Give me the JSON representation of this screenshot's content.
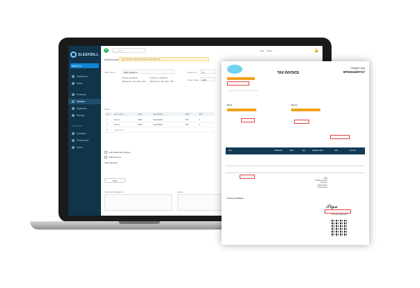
{
  "app": {
    "brand": "SLEEKBILL",
    "company_selector": "Demo Co",
    "search_placeholder": "Search",
    "topbar_links": [
      "Help",
      "Share"
    ],
    "form_title": "Edit Invoice",
    "warning": "Your GSTR-1 for this period is not filed yet"
  },
  "sidebar": {
    "items": [
      {
        "label": "Dashboard"
      },
      {
        "label": "Sales"
      },
      {
        "label": "Purchase"
      },
      {
        "label": "Invoices"
      },
      {
        "label": "Expenses"
      },
      {
        "label": "Reports"
      }
    ],
    "section": "SETTINGS",
    "settings_items": [
      {
        "label": "Company"
      },
      {
        "label": "Preferences"
      },
      {
        "label": "Users"
      }
    ]
  },
  "invoice_form": {
    "party_label": "Party name",
    "party_value": "ABC Solutions",
    "billing_label": "BILLING ADDRESS",
    "shipping_label": "SHIPPING ADDRESS",
    "billing_address": "Address line, City, State - PIN",
    "shipping_address": "Address line, City, State - PIN",
    "invoice_no_label": "Invoice no",
    "invoice_no_value": "12",
    "date_label": "Invoice date",
    "date_value": "2021",
    "items_label": "Items",
    "columns": [
      "No",
      "Item name",
      "HSN",
      "Description",
      "Rate",
      "QTY"
    ],
    "rows": [
      {
        "no": "1",
        "name": "Item 1",
        "hsn": "1001",
        "desc": "Description",
        "rate": "100",
        "qty": "1"
      },
      {
        "no": "2",
        "name": "Item 2",
        "hsn": "1002",
        "desc": "Description",
        "rate": "100",
        "qty": "1"
      },
      {
        "no": "3",
        "name": "Select item",
        "hsn": "",
        "desc": "",
        "rate": "",
        "qty": ""
      }
    ],
    "checkboxes": [
      "Add Additional Charges",
      "Add Discount"
    ],
    "add_signature": "Add Signature",
    "save_button": "Save",
    "terms_label": "Terms & Conditions",
    "notes_label": "Notes"
  },
  "invoice_doc": {
    "title": "TAX INVOICE",
    "copy_label": "Original Copy",
    "invoice_number": "SPI/2024/07/17",
    "bill_to": "Bill To",
    "ship_to": "Ship To",
    "table_headers": [
      "Item",
      "HSN/SAC",
      "Rate",
      "Qty",
      "Taxable Value",
      "GST",
      "Amount"
    ],
    "totals": [
      "Total",
      "Taxable Amount",
      "Total Tax",
      "Total Amount",
      "Amount Due"
    ],
    "terms_label": "Terms & Conditions",
    "signature": "Authorised Signatory"
  },
  "colors": {
    "sidebar": "#12344a",
    "accent": "#0e86d4",
    "highlight": "#f4a21a",
    "invoice_header": "#123a55"
  }
}
